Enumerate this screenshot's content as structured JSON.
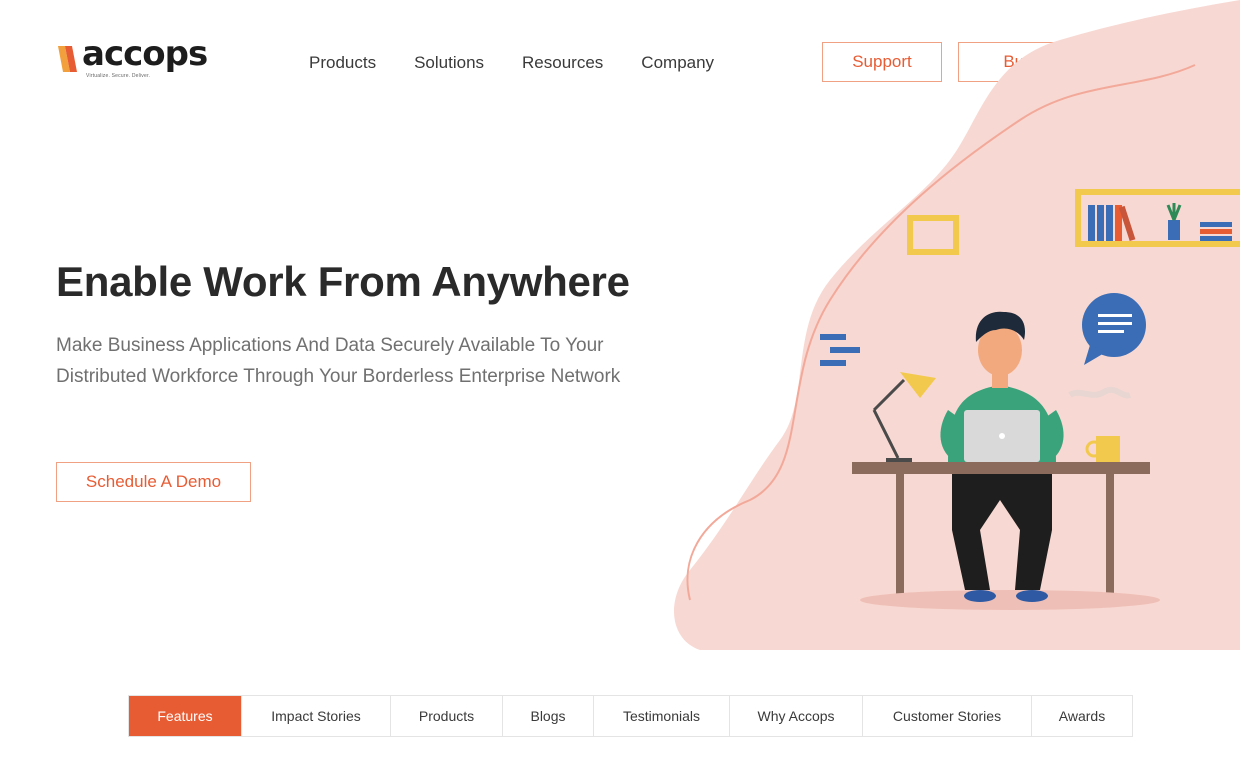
{
  "brand": {
    "name": "accops",
    "tagline": "Virtualize. Secure. Deliver."
  },
  "nav": {
    "items": [
      "Products",
      "Solutions",
      "Resources",
      "Company"
    ],
    "support_label": "Support",
    "buy_label": "Buy"
  },
  "hero": {
    "title": "Enable Work From Anywhere",
    "subtitle": "Make Business Applications And Data Securely Available To Your Distributed Workforce Through Your Borderless Enterprise Network",
    "cta_label": "Schedule A Demo"
  },
  "tabs": {
    "active": "Features",
    "items": [
      "Features",
      "Impact Stories",
      "Products",
      "Blogs",
      "Testimonials",
      "Why Accops",
      "Customer Stories",
      "Awards"
    ]
  },
  "colors": {
    "accent": "#e85c34",
    "accent_border": "#f0a083",
    "blob": "#f8d8d2",
    "shirt": "#3aa37b",
    "chat_bubble": "#3a6db5",
    "shelf": "#f2c94c"
  }
}
